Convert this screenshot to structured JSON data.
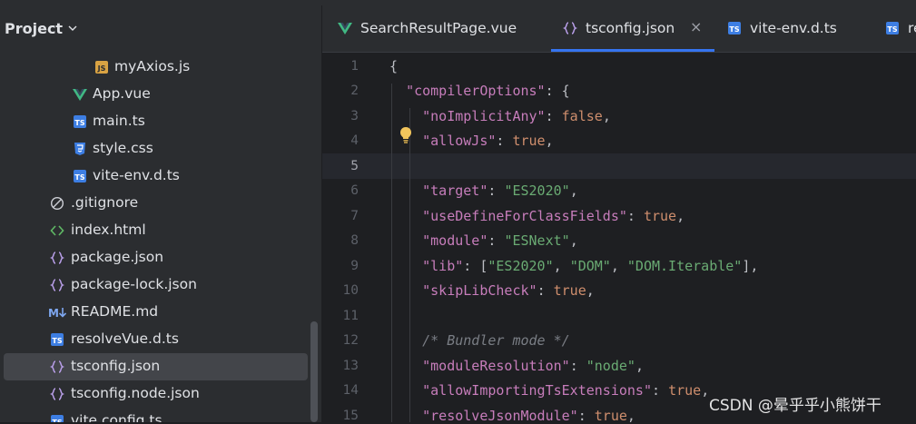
{
  "project_panel": {
    "title": "Project",
    "items": [
      {
        "label": "myAxios.js",
        "icon": "js-file-icon"
      },
      {
        "label": "App.vue",
        "icon": "vue-file-icon"
      },
      {
        "label": "main.ts",
        "icon": "ts-file-icon"
      },
      {
        "label": "style.css",
        "icon": "css-file-icon"
      },
      {
        "label": "vite-env.d.ts",
        "icon": "ts-file-icon"
      },
      {
        "label": ".gitignore",
        "icon": "ignore-file-icon"
      },
      {
        "label": "index.html",
        "icon": "html-file-icon"
      },
      {
        "label": "package.json",
        "icon": "json-file-icon"
      },
      {
        "label": "package-lock.json",
        "icon": "json-file-icon"
      },
      {
        "label": "README.md",
        "icon": "markdown-file-icon"
      },
      {
        "label": "resolveVue.d.ts",
        "icon": "ts-file-icon"
      },
      {
        "label": "tsconfig.json",
        "icon": "json-file-icon",
        "selected": true
      },
      {
        "label": "tsconfig.node.json",
        "icon": "json-file-icon"
      },
      {
        "label": "vite.config.ts",
        "icon": "ts-file-icon"
      }
    ]
  },
  "tabs": [
    {
      "label": "SearchResultPage.vue",
      "icon": "vue-file-icon"
    },
    {
      "label": "tsconfig.json",
      "icon": "json-file-icon",
      "active": true,
      "close": "×"
    },
    {
      "label": "vite-env.d.ts",
      "icon": "ts-file-icon"
    },
    {
      "label": "re",
      "icon": "ts-file-icon"
    }
  ],
  "editor": {
    "line_numbers": [
      "1",
      "2",
      "3",
      "4",
      "5",
      "6",
      "7",
      "8",
      "9",
      "10",
      "11",
      "12",
      "13",
      "14",
      "15"
    ],
    "lines": [
      "{",
      "  \"compilerOptions\": {",
      "    \"noImplicitAny\": false,",
      "    \"allowJs\": true,",
      "",
      "    \"target\": \"ES2020\",",
      "    \"useDefineForClassFields\": true,",
      "    \"module\": \"ESNext\",",
      "    \"lib\": [\"ES2020\", \"DOM\", \"DOM.Iterable\"],",
      "    \"skipLibCheck\": true,",
      "",
      "    /* Bundler mode */",
      "    \"moduleResolution\": \"node\",",
      "    \"allowImportingTsExtensions\": true,",
      "    \"resolveJsonModule\": true,"
    ]
  },
  "colors": {
    "accent": "#3574f0",
    "key": "#c77dbb",
    "string": "#6aab73",
    "keyword": "#cf8e6d"
  },
  "watermark": "CSDN @晕乎乎小熊饼干"
}
